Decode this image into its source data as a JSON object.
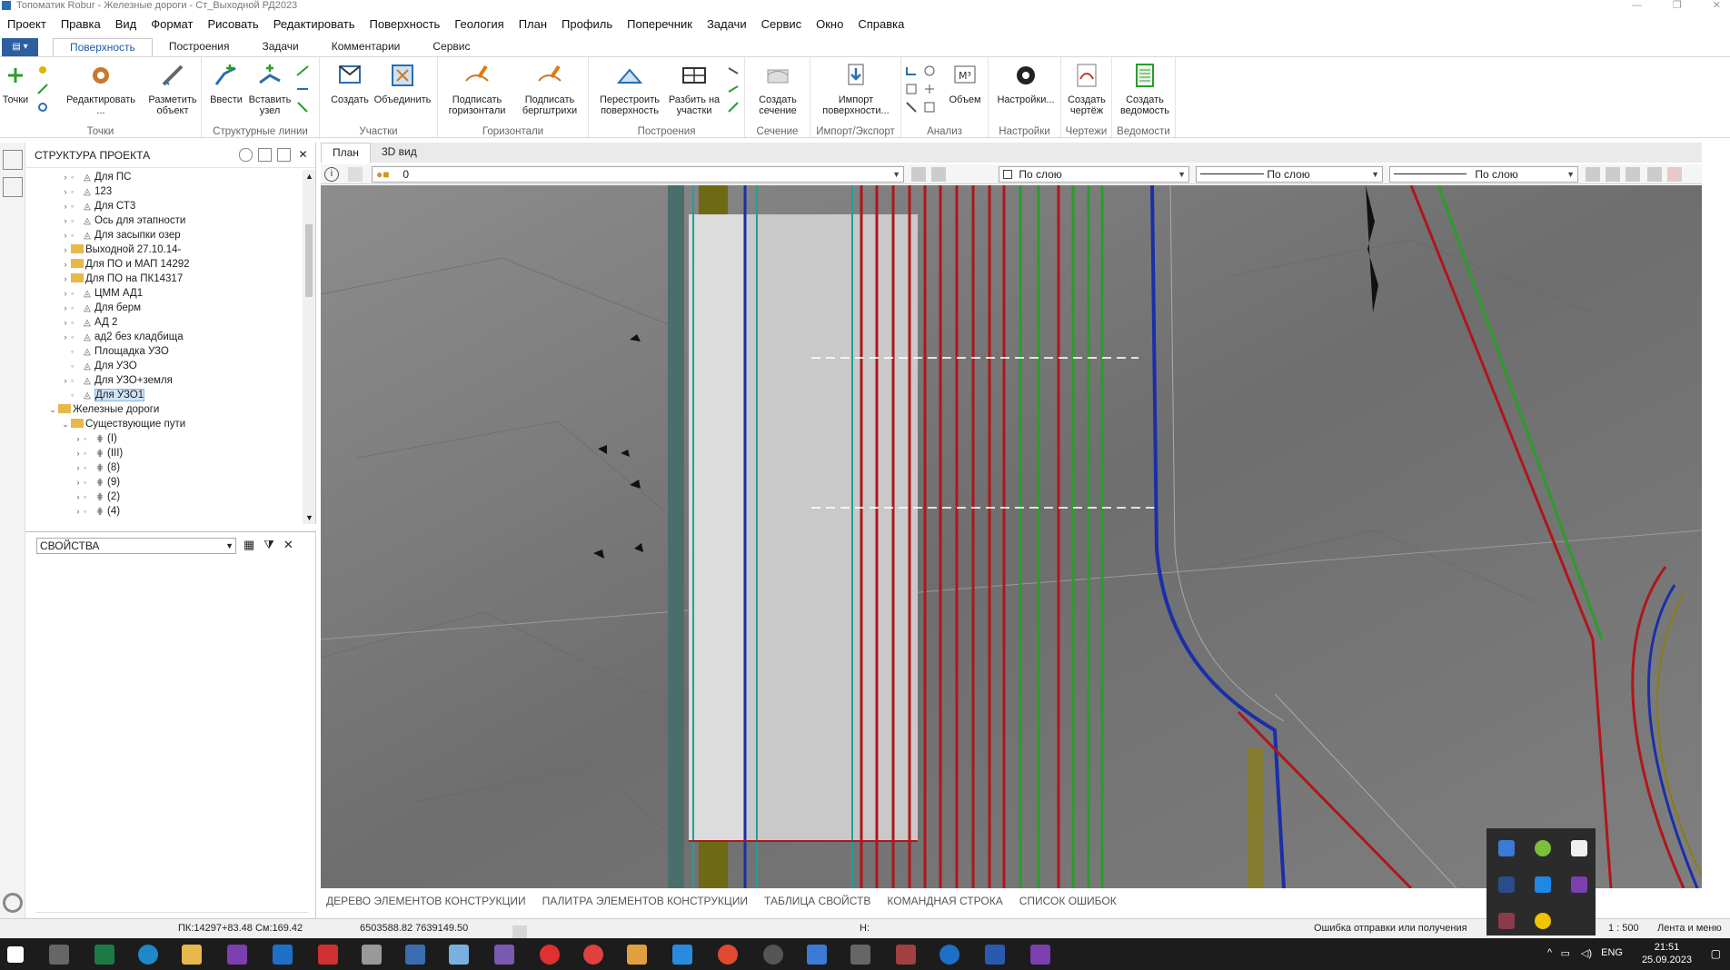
{
  "window": {
    "title": "Топоматик Robur - Железные дороги - Ст_Выходной РД2023"
  },
  "menu": [
    "Проект",
    "Правка",
    "Вид",
    "Формат",
    "Рисовать",
    "Редактировать",
    "Поверхность",
    "Геология",
    "План",
    "Профиль",
    "Поперечник",
    "Задачи",
    "Сервис",
    "Окно",
    "Справка"
  ],
  "ribbon_tabs": [
    "Поверхность",
    "Построения",
    "Задачи",
    "Комментарии",
    "Сервис"
  ],
  "ribbon": {
    "points_btn": "Точки",
    "edit_btn": [
      "Редактировать",
      "..."
    ],
    "mark_btn": [
      "Разметить",
      "объект"
    ],
    "group_points": "Точки",
    "enter_btn": "Ввести",
    "insert_node_btn": [
      "Вставить",
      "узел"
    ],
    "group_struct": "Структурные линии",
    "create_btn": "Создать",
    "merge_btn": "Объединить",
    "group_areas": "Участки",
    "sign_horiz_btn": [
      "Подписать",
      "горизонтали"
    ],
    "sign_berg_btn": [
      "Подписать",
      "бергштрихи"
    ],
    "group_horiz": "Горизонтали",
    "rebuild_btn": [
      "Перестроить",
      "поверхность"
    ],
    "split_btn": [
      "Разбить на",
      "участки"
    ],
    "group_build": "Построения",
    "section_btn": [
      "Создать",
      "сечение"
    ],
    "group_section": "Сечение",
    "import_btn": [
      "Импорт",
      "поверхности..."
    ],
    "group_import": "Импорт/Экспорт",
    "volume_btn": "Объем",
    "group_analysis": "Анализ",
    "settings_btn": "Настройки...",
    "group_settings": "Настройки",
    "drawing_btn": [
      "Создать",
      "чертёж"
    ],
    "group_drawings": "Чертежи",
    "sheet_btn": [
      "Создать",
      "ведомость"
    ],
    "group_sheets": "Ведомости"
  },
  "project_panel": {
    "title": "СТРУКТУРА ПРОЕКТА",
    "items": [
      {
        "label": "Для ПС",
        "type": "surface"
      },
      {
        "label": "123",
        "type": "surface"
      },
      {
        "label": "Для СТ3",
        "type": "surface"
      },
      {
        "label": "Ось для этапности",
        "type": "line"
      },
      {
        "label": "Для засыпки озер",
        "type": "surface"
      },
      {
        "label": "Выходной 27.10.14-",
        "type": "folder"
      },
      {
        "label": "Для ПО и МАП 14292",
        "type": "folder"
      },
      {
        "label": "Для ПО на ПК14317",
        "type": "folder"
      },
      {
        "label": "ЦММ АД1",
        "type": "surface"
      },
      {
        "label": "Для берм",
        "type": "surface"
      },
      {
        "label": "АД 2",
        "type": "surface"
      },
      {
        "label": "ад2 без кладбища",
        "type": "surface"
      },
      {
        "label": "Площадка УЗО",
        "type": "surface"
      },
      {
        "label": "Для УЗО",
        "type": "surface"
      },
      {
        "label": "Для УЗО+земля",
        "type": "surface"
      },
      {
        "label": "Для УЗО1",
        "type": "surface",
        "selected": true
      },
      {
        "label": "Железные дороги",
        "type": "folder-open"
      },
      {
        "label": "Существующие пути",
        "type": "folder-open"
      },
      {
        "label": "(I)",
        "type": "rail"
      },
      {
        "label": "(III)",
        "type": "rail"
      },
      {
        "label": "(8)",
        "type": "rail"
      },
      {
        "label": "(9)",
        "type": "rail"
      },
      {
        "label": "(2)",
        "type": "rail"
      },
      {
        "label": "(4)",
        "type": "rail"
      }
    ]
  },
  "properties_panel": {
    "selector": "СВОЙСТВА"
  },
  "doc_tabs": [
    "План",
    "3D вид"
  ],
  "view_toolbar": {
    "layer_value": "0",
    "color_combo": "По слою",
    "linetype_combo": "По слою",
    "lineweight_combo": "По слою"
  },
  "bottom_tabs": [
    "ДЕРЕВО ЭЛЕМЕНТОВ КОНСТРУКЦИИ",
    "ПАЛИТРА ЭЛЕМЕНТОВ КОНСТРУКЦИИ",
    "ТАБЛИЦА СВОЙСТВ",
    "КОМАНДНАЯ СТРОКА",
    "СПИСОК ОШИБОК"
  ],
  "status": {
    "pk": "ПК:14297+83.48 См:169.42",
    "coords": "6503588.82 7639149.50",
    "h": "H:",
    "message": "Ошибка отправки или получения",
    "scale": "1 : 500",
    "mode": "Лента и меню"
  },
  "taskbar": {
    "lang": "ENG",
    "time": "21:51",
    "date": "25.09.2023"
  },
  "colors": {
    "accent": "#1e5aa8",
    "red_track": "#b0161a",
    "green_track": "#2a9d2a",
    "blue_track": "#1a2fa8",
    "teal_track": "#1aa39a",
    "olive": "#8a7d10"
  }
}
